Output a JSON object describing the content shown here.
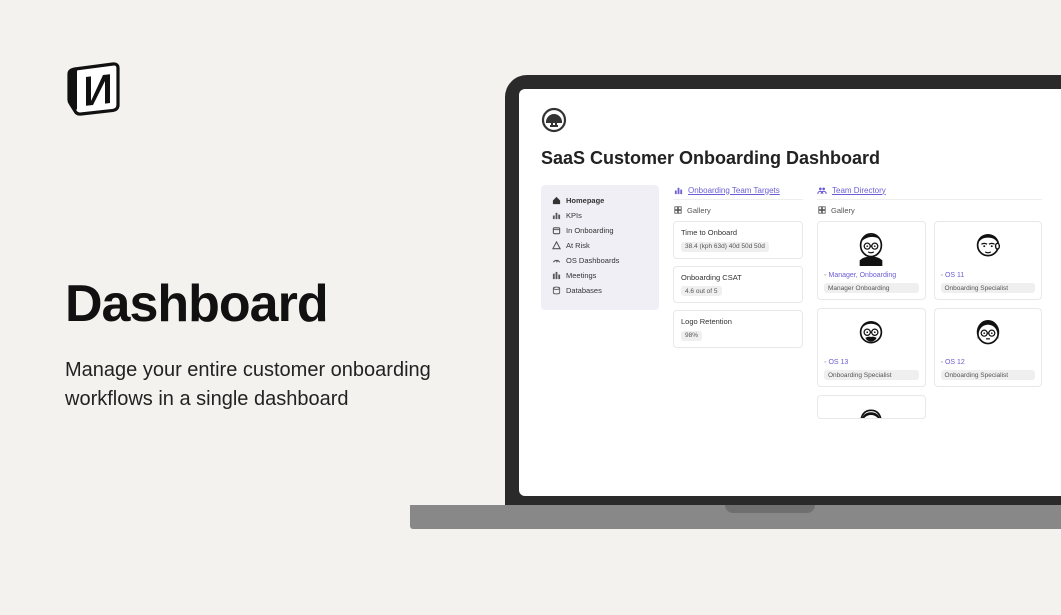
{
  "hero": {
    "title": "Dashboard",
    "subtitle": "Manage your entire customer onboarding workflows in a single dashboard"
  },
  "app": {
    "title": "SaaS Customer Onboarding Dashboard"
  },
  "sidebar": {
    "home": "Homepage",
    "items": [
      {
        "label": "KPIs"
      },
      {
        "label": "In Onboarding"
      },
      {
        "label": "At Risk"
      },
      {
        "label": "OS Dashboards"
      },
      {
        "label": "Meetings"
      },
      {
        "label": "Databases"
      }
    ]
  },
  "targets": {
    "title": "Onboarding Team Targets",
    "view": "Gallery",
    "cards": [
      {
        "title": "Time to Onboard",
        "value": "38.4 (kph 63d) 40d 50d 50d"
      },
      {
        "title": "Onboarding CSAT",
        "value": "4.6 out of 5"
      },
      {
        "title": "Logo Retention",
        "value": "98%"
      }
    ]
  },
  "directory": {
    "title": "Team Directory",
    "view": "Gallery",
    "people": [
      {
        "name": "Manager, Onboarding",
        "role": "Manager Onboarding"
      },
      {
        "name": "OS 11",
        "role": "Onboarding Specialist"
      },
      {
        "name": "OS 13",
        "role": "Onboarding Specialist"
      },
      {
        "name": "OS 12",
        "role": "Onboarding Specialist"
      }
    ]
  }
}
